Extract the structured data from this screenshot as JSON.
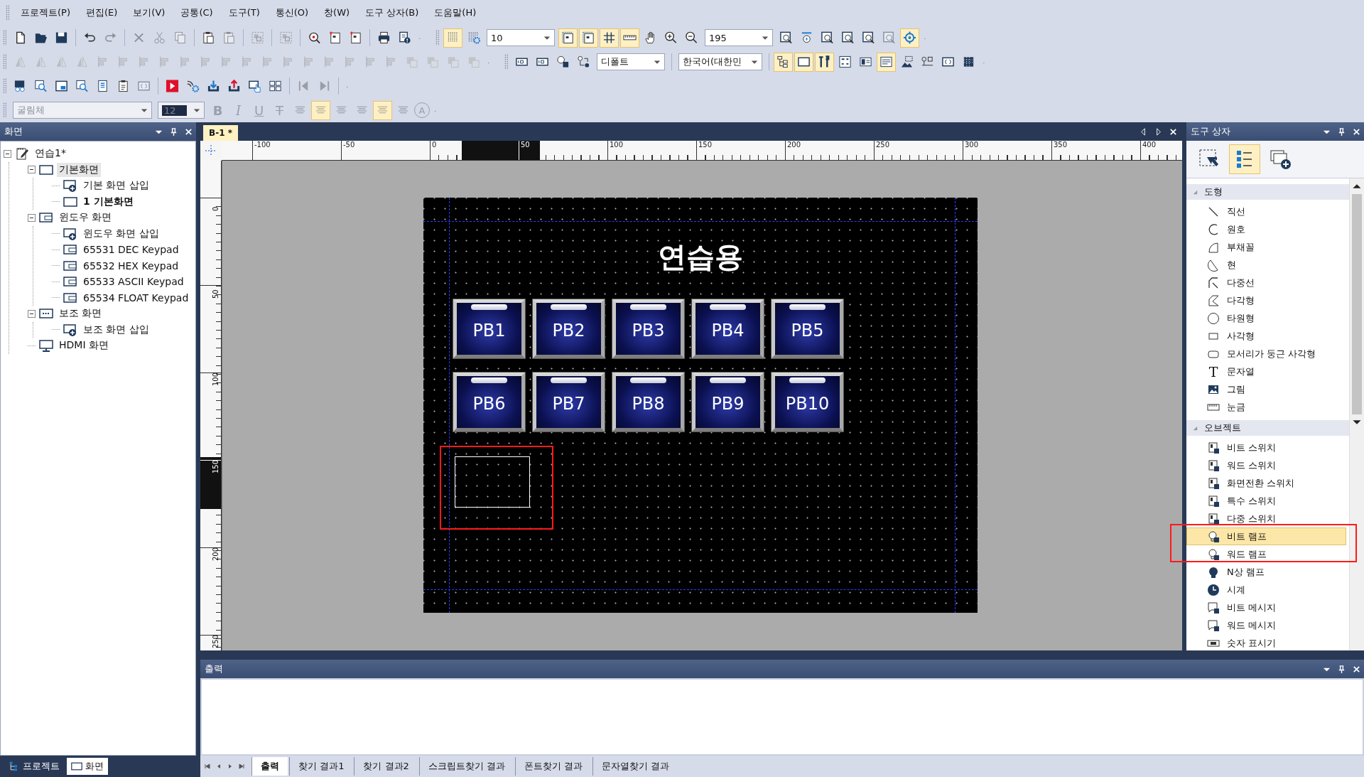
{
  "menu": [
    "프로젝트(P)",
    "편집(E)",
    "보기(V)",
    "공통(C)",
    "도구(T)",
    "통신(O)",
    "창(W)",
    "도구 상자(B)",
    "도움말(H)"
  ],
  "toolbar_rows": [
    {
      "toolbars": [
        {
          "groups": [
            [
              {
                "kind": "new",
                "on": false,
                "disabled": false
              },
              {
                "kind": "open",
                "on": false,
                "disabled": false
              },
              {
                "kind": "save",
                "on": false,
                "disabled": false
              }
            ],
            [
              {
                "kind": "undo",
                "on": false,
                "disabled": false
              },
              {
                "kind": "redo",
                "on": false,
                "disabled": true
              }
            ],
            [
              {
                "kind": "delete",
                "on": false,
                "disabled": true
              },
              {
                "kind": "cut",
                "on": false,
                "disabled": true
              },
              {
                "kind": "copy",
                "on": false,
                "disabled": true
              }
            ],
            [
              {
                "kind": "paste",
                "on": false,
                "disabled": false
              },
              {
                "kind": "paste",
                "on": false,
                "disabled": true
              }
            ],
            [
              {
                "kind": "group",
                "on": false,
                "disabled": true
              }
            ],
            [
              {
                "kind": "group",
                "on": false,
                "disabled": true
              }
            ],
            [
              {
                "kind": "findpoint",
                "on": false,
                "disabled": false
              },
              {
                "kind": "frame",
                "on": false,
                "disabled": false
              },
              {
                "kind": "frame",
                "on": false,
                "disabled": false
              }
            ],
            [
              {
                "kind": "print",
                "on": false,
                "disabled": false
              },
              {
                "kind": "check",
                "on": false,
                "disabled": false
              },
              {
                "kind": "more"
              }
            ]
          ]
        },
        {
          "groups": [
            [
              {
                "kind": "grid",
                "on": true,
                "disabled": false
              },
              {
                "kind": "gridgear",
                "on": false,
                "disabled": false
              },
              {
                "kind": "number-combo",
                "value": "10",
                "disabled": false
              },
              {
                "kind": "frame2",
                "on": true,
                "disabled": false
              },
              {
                "kind": "frame2",
                "on": true,
                "disabled": false
              },
              {
                "kind": "gridlines",
                "on": true,
                "disabled": false
              },
              {
                "kind": "ruler",
                "on": true,
                "disabled": false
              },
              {
                "kind": "hand",
                "on": false,
                "disabled": false
              },
              {
                "kind": "zoomin",
                "on": false,
                "disabled": false
              },
              {
                "kind": "zoomout",
                "on": false,
                "disabled": false
              },
              {
                "kind": "number-combo",
                "value": "195",
                "disabled": false
              },
              {
                "kind": "zoomarea",
                "on": false,
                "disabled": false
              },
              {
                "kind": "zoom100",
                "on": false,
                "disabled": false
              },
              {
                "kind": "zoomarea",
                "on": false,
                "disabled": false
              },
              {
                "kind": "zoomarea",
                "on": false,
                "disabled": false
              },
              {
                "kind": "zoomarea",
                "on": false,
                "disabled": false
              },
              {
                "kind": "zoomarea",
                "on": false,
                "disabled": true
              },
              {
                "kind": "target",
                "on": true,
                "disabled": false
              },
              {
                "kind": "more"
              }
            ]
          ]
        }
      ]
    },
    {
      "toolbars": [
        {
          "groups": [
            [
              {
                "kind": "flip",
                "on": false,
                "disabled": true
              },
              {
                "kind": "flip",
                "on": false,
                "disabled": true
              },
              {
                "kind": "flip",
                "on": false,
                "disabled": true
              },
              {
                "kind": "flip",
                "on": false,
                "disabled": true
              },
              {
                "kind": "align",
                "on": false,
                "disabled": true
              },
              {
                "kind": "align",
                "on": false,
                "disabled": true
              },
              {
                "kind": "align",
                "on": false,
                "disabled": true
              },
              {
                "kind": "align",
                "on": false,
                "disabled": true
              },
              {
                "kind": "align",
                "on": false,
                "disabled": true
              },
              {
                "kind": "align",
                "on": false,
                "disabled": true
              },
              {
                "kind": "align",
                "on": false,
                "disabled": true
              },
              {
                "kind": "align",
                "on": false,
                "disabled": true
              },
              {
                "kind": "align",
                "on": false,
                "disabled": true
              },
              {
                "kind": "align",
                "on": false,
                "disabled": true
              },
              {
                "kind": "align",
                "on": false,
                "disabled": true
              },
              {
                "kind": "align",
                "on": false,
                "disabled": true
              },
              {
                "kind": "align",
                "on": false,
                "disabled": true
              },
              {
                "kind": "align",
                "on": false,
                "disabled": true
              },
              {
                "kind": "align",
                "on": false,
                "disabled": true
              },
              {
                "kind": "layer",
                "on": false,
                "disabled": true
              },
              {
                "kind": "layer",
                "on": false,
                "disabled": true
              },
              {
                "kind": "layer",
                "on": false,
                "disabled": true
              },
              {
                "kind": "layer",
                "on": false,
                "disabled": true
              },
              {
                "kind": "more"
              }
            ]
          ]
        },
        {
          "groups": [
            [
              {
                "kind": "tag",
                "on": false,
                "disabled": false
              },
              {
                "kind": "tag",
                "on": false,
                "disabled": false
              },
              {
                "kind": "stepnum",
                "on": false,
                "disabled": false
              },
              {
                "kind": "swap",
                "on": false,
                "disabled": false
              },
              {
                "kind": "style-combo",
                "value": "디폴트",
                "disabled": false
              }
            ],
            [
              {
                "kind": "language-combo",
                "value": "한국어(대한민",
                "disabled": false
              }
            ],
            [
              {
                "kind": "tree",
                "on": true,
                "disabled": false
              },
              {
                "kind": "window",
                "on": true,
                "disabled": false
              },
              {
                "kind": "tools",
                "on": true,
                "disabled": false
              },
              {
                "kind": "form",
                "on": false,
                "disabled": false
              },
              {
                "kind": "panel",
                "on": false,
                "disabled": false
              },
              {
                "kind": "listpanel",
                "on": true,
                "disabled": false
              },
              {
                "kind": "picture",
                "on": false,
                "disabled": false
              },
              {
                "kind": "sensors",
                "on": false,
                "disabled": false
              },
              {
                "kind": "braces",
                "on": false,
                "disabled": false
              },
              {
                "kind": "matrix",
                "on": false,
                "disabled": false
              },
              {
                "kind": "more"
              }
            ]
          ]
        }
      ]
    },
    {
      "toolbars": [
        {
          "groups": [
            [
              {
                "kind": "device",
                "on": false,
                "disabled": false
              },
              {
                "kind": "docsearch",
                "on": false,
                "disabled": false
              },
              {
                "kind": "screenin",
                "on": false,
                "disabled": false
              },
              {
                "kind": "docsearch",
                "on": false,
                "disabled": false
              },
              {
                "kind": "listdoc",
                "on": false,
                "disabled": false
              },
              {
                "kind": "checklist",
                "on": false,
                "disabled": false
              },
              {
                "kind": "braces",
                "on": false,
                "disabled": true
              }
            ],
            [
              {
                "kind": "play",
                "on": false,
                "disabled": false
              },
              {
                "kind": "signal",
                "on": false,
                "disabled": false
              },
              {
                "kind": "download",
                "on": false,
                "disabled": false
              },
              {
                "kind": "upload",
                "on": false,
                "disabled": false
              },
              {
                "kind": "touch",
                "on": false,
                "disabled": false
              },
              {
                "kind": "tiles",
                "on": false,
                "disabled": false
              }
            ],
            [
              {
                "kind": "first",
                "on": false,
                "disabled": true
              },
              {
                "kind": "last",
                "on": false,
                "disabled": true
              }
            ],
            [
              {
                "kind": "more"
              }
            ]
          ]
        }
      ]
    },
    {
      "toolbars": [
        {
          "groups": [
            [
              {
                "kind": "font-combo",
                "value": "굴림체",
                "disabled": true
              },
              {
                "kind": "size-combo",
                "value": "12",
                "disabled": true
              },
              {
                "kind": "bold",
                "label": "B",
                "on": false,
                "disabled": true
              },
              {
                "kind": "italic",
                "label": "I",
                "on": false,
                "disabled": true
              },
              {
                "kind": "underline",
                "label": "U",
                "on": false,
                "disabled": true
              },
              {
                "kind": "strike",
                "label": "T",
                "on": false,
                "disabled": true
              },
              {
                "kind": "textalign",
                "on": false,
                "disabled": true
              },
              {
                "kind": "textalign",
                "on": true,
                "disabled": true
              },
              {
                "kind": "textalign",
                "on": false,
                "disabled": true
              },
              {
                "kind": "textalign",
                "on": false,
                "disabled": true
              },
              {
                "kind": "textalign",
                "on": true,
                "disabled": true
              },
              {
                "kind": "textalign",
                "on": false,
                "disabled": true
              },
              {
                "kind": "text-color",
                "label": "A",
                "on": false,
                "disabled": true
              },
              {
                "kind": "more"
              }
            ]
          ]
        }
      ]
    }
  ],
  "screen_panel": {
    "title": "화면",
    "tree": [
      {
        "label": "연습1*",
        "kind": "project",
        "expanded": true,
        "selected": false,
        "open": false,
        "children": [
          {
            "label": "기본화면",
            "kind": "screen",
            "expanded": true,
            "selected": true,
            "open": false,
            "children": [
              {
                "label": "기본 화면 삽입",
                "kind": "insert",
                "selected": false,
                "open": false
              },
              {
                "label": "1 기본화면",
                "kind": "screen",
                "selected": false,
                "open": true
              }
            ]
          },
          {
            "label": "윈도우 화면",
            "kind": "window",
            "expanded": true,
            "selected": false,
            "open": false,
            "children": [
              {
                "label": "윈도우 화면 삽입",
                "kind": "insert",
                "selected": false,
                "open": false
              },
              {
                "label": "65531 DEC Keypad",
                "kind": "window",
                "selected": false,
                "open": false
              },
              {
                "label": "65532 HEX Keypad",
                "kind": "window",
                "selected": false,
                "open": false
              },
              {
                "label": "65533 ASCII Keypad",
                "kind": "window",
                "selected": false,
                "open": false
              },
              {
                "label": "65534 FLOAT Keypad",
                "kind": "window",
                "selected": false,
                "open": false
              }
            ]
          },
          {
            "label": "보조 화면",
            "kind": "aux",
            "expanded": true,
            "selected": false,
            "open": false,
            "children": [
              {
                "label": "보조 화면 삽입",
                "kind": "insert",
                "selected": false,
                "open": false
              }
            ]
          },
          {
            "label": "HDMI 화면",
            "kind": "hdmi",
            "selected": false,
            "open": false
          }
        ]
      }
    ],
    "tabs": [
      {
        "label": "프로젝트",
        "kind": "tree",
        "selected": false
      },
      {
        "label": "화면",
        "kind": "screen",
        "selected": true
      }
    ]
  },
  "document": {
    "tab": "B-1 *",
    "x_ruler": [
      "-100",
      "-50",
      "0",
      "50",
      "100",
      "150",
      "200",
      "250",
      "300",
      "350",
      "400"
    ],
    "y_ruler": [
      "0",
      "50",
      "100",
      "150",
      "200",
      "250"
    ],
    "screen": {
      "title": "연습용",
      "buttons": [
        "PB1",
        "PB2",
        "PB3",
        "PB4",
        "PB5",
        "PB6",
        "PB7",
        "PB8",
        "PB9",
        "PB10"
      ]
    }
  },
  "toolbox": {
    "title": "도구 상자",
    "view_buttons": [
      {
        "kind": "pointer",
        "on": false
      },
      {
        "kind": "list",
        "on": true
      },
      {
        "kind": "add",
        "on": false
      }
    ],
    "sections": [
      {
        "title": "도형",
        "expanded": true,
        "items": [
          {
            "label": "직선",
            "kind": "line",
            "selected": false
          },
          {
            "label": "원호",
            "kind": "arc",
            "selected": false
          },
          {
            "label": "부채꼴",
            "kind": "sector",
            "selected": false
          },
          {
            "label": "현",
            "kind": "chord",
            "selected": false
          },
          {
            "label": "다중선",
            "kind": "polyline",
            "selected": false
          },
          {
            "label": "다각형",
            "kind": "polygon",
            "selected": false
          },
          {
            "label": "타원형",
            "kind": "ellipse",
            "selected": false
          },
          {
            "label": "사각형",
            "kind": "rect",
            "selected": false
          },
          {
            "label": "모서리가 둥근 사각형",
            "kind": "roundrect",
            "selected": false
          },
          {
            "label": "문자열",
            "kind": "text",
            "glyph": "T",
            "selected": false
          },
          {
            "label": "그림",
            "kind": "image",
            "selected": false
          },
          {
            "label": "눈금",
            "kind": "scale",
            "selected": false
          }
        ]
      },
      {
        "title": "오브젝트",
        "expanded": true,
        "items": [
          {
            "label": "비트 스위치",
            "kind": "switch",
            "selected": false
          },
          {
            "label": "워드 스위치",
            "kind": "switch",
            "selected": false
          },
          {
            "label": "화면전환 스위치",
            "kind": "switch",
            "selected": false
          },
          {
            "label": "특수 스위치",
            "kind": "switch",
            "selected": false
          },
          {
            "label": "다중 스위치",
            "kind": "switch",
            "selected": false
          },
          {
            "label": "비트 램프",
            "kind": "lamp",
            "selected": true
          },
          {
            "label": "워드 램프",
            "kind": "lamp",
            "selected": false
          },
          {
            "label": "N상 램프",
            "kind": "nlamp",
            "selected": false
          },
          {
            "label": "시계",
            "kind": "clock",
            "selected": false
          },
          {
            "label": "비트 메시지",
            "kind": "message",
            "selected": false
          },
          {
            "label": "워드 메시지",
            "kind": "message",
            "selected": false
          },
          {
            "label": "숫자 표시기",
            "kind": "numeric",
            "selected": false
          }
        ]
      }
    ]
  },
  "output_panel": {
    "title": "출력",
    "tabs": [
      {
        "label": "출력",
        "selected": true
      },
      {
        "label": "찾기 결과1",
        "selected": false
      },
      {
        "label": "찾기 결과2",
        "selected": false
      },
      {
        "label": "스크립트찾기 결과",
        "selected": false
      },
      {
        "label": "폰트찾기 결과",
        "selected": false
      },
      {
        "label": "문자열찾기 결과",
        "selected": false
      }
    ]
  }
}
